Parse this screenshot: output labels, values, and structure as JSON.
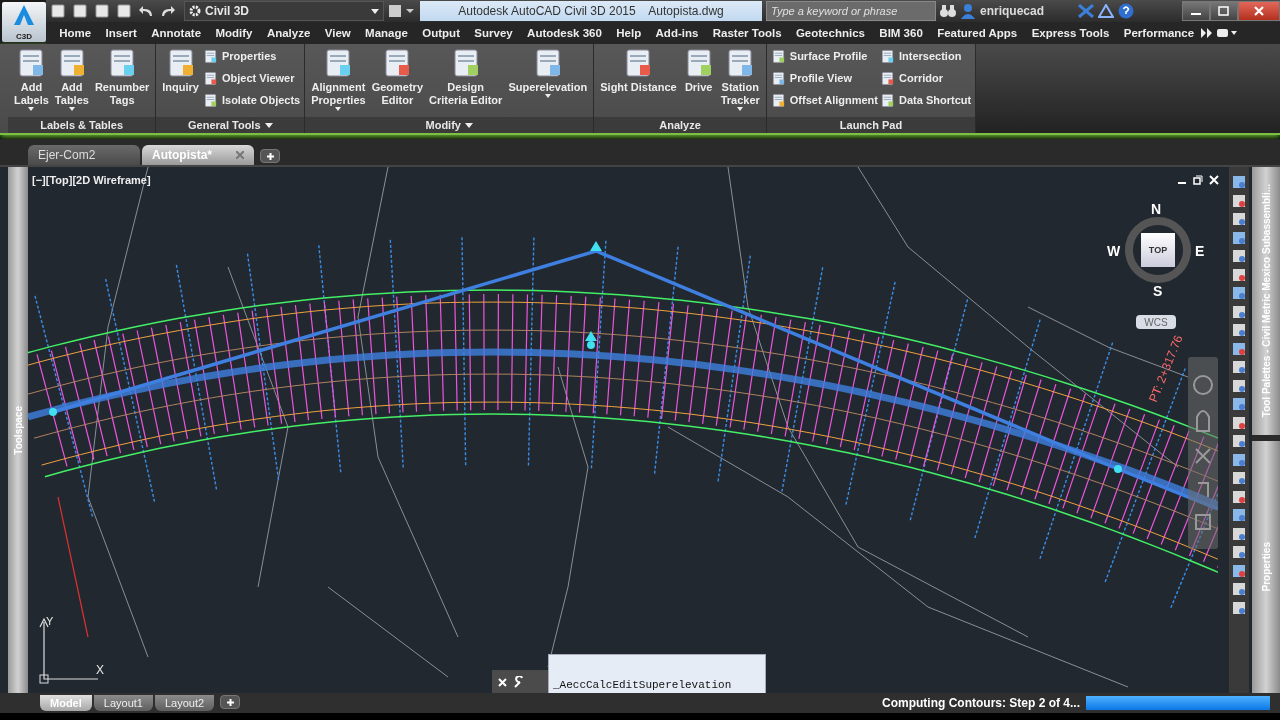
{
  "app_button": {
    "label": "C3D"
  },
  "quick_access": {
    "workspace": "Civil 3D"
  },
  "title_bar": {
    "title": "Autodesk AutoCAD Civil 3D 2015    Autopista.dwg",
    "search": {
      "placeholder": "Type a keyword or phrase"
    },
    "user": "enriquecad"
  },
  "menu_tabs": [
    {
      "label": "Home",
      "selected": false
    },
    {
      "label": "Insert",
      "selected": false
    },
    {
      "label": "Annotate",
      "selected": false
    },
    {
      "label": "Modify",
      "selected": false
    },
    {
      "label": "Analyze",
      "selected": false
    },
    {
      "label": "View",
      "selected": false
    },
    {
      "label": "Manage",
      "selected": false
    },
    {
      "label": "Output",
      "selected": false
    },
    {
      "label": "Survey",
      "selected": false
    },
    {
      "label": "Autodesk 360",
      "selected": false
    },
    {
      "label": "Help",
      "selected": false
    },
    {
      "label": "Add-ins",
      "selected": false
    },
    {
      "label": "Raster Tools",
      "selected": false
    },
    {
      "label": "Geotechnics",
      "selected": false
    },
    {
      "label": "BIM 360",
      "selected": false
    },
    {
      "label": "Featured Apps",
      "selected": false
    },
    {
      "label": "Express Tools",
      "selected": false
    },
    {
      "label": "Performance",
      "selected": false
    }
  ],
  "ribbon_panels": [
    {
      "title": "Labels & Tables",
      "menu": false,
      "items": [
        {
          "kind": "large",
          "label": "Add\nLabels",
          "dropdown": true
        },
        {
          "kind": "large",
          "label": "Add\nTables",
          "dropdown": true
        },
        {
          "kind": "large",
          "label": "Renumber\nTags",
          "dropdown": false
        }
      ]
    },
    {
      "title": "General Tools",
      "menu": true,
      "items": [
        {
          "kind": "large",
          "label": "Inquiry",
          "dropdown": false
        },
        {
          "kind": "small",
          "label": "Properties"
        },
        {
          "kind": "small",
          "label": "Object Viewer"
        },
        {
          "kind": "small",
          "label": "Isolate Objects"
        }
      ]
    },
    {
      "title": "Modify",
      "menu": true,
      "items": [
        {
          "kind": "large",
          "label": "Alignment\nProperties",
          "dropdown": true
        },
        {
          "kind": "large",
          "label": "Geometry\nEditor",
          "dropdown": false
        },
        {
          "kind": "large",
          "label": "Design\nCriteria Editor",
          "dropdown": false
        },
        {
          "kind": "large",
          "label": "Superelevation",
          "dropdown": true
        }
      ]
    },
    {
      "title": "Analyze",
      "menu": false,
      "items": [
        {
          "kind": "large",
          "label": "Sight Distance",
          "dropdown": false
        },
        {
          "kind": "large",
          "label": "Drive",
          "dropdown": false
        },
        {
          "kind": "large",
          "label": "Station\nTracker",
          "dropdown": true
        }
      ]
    },
    {
      "title": "Launch Pad",
      "menu": false,
      "items": [
        {
          "kind": "small",
          "label": "Surface Profile"
        },
        {
          "kind": "small",
          "label": "Profile View"
        },
        {
          "kind": "small",
          "label": "Offset Alignment"
        },
        {
          "kind": "small",
          "label": "Intersection"
        },
        {
          "kind": "small",
          "label": "Corridor"
        },
        {
          "kind": "small",
          "label": "Data Shortcut"
        }
      ]
    }
  ],
  "document_tabs": [
    {
      "label": "Ejer-Com2",
      "selected": false
    },
    {
      "label": "Autopista*",
      "selected": true
    }
  ],
  "toolspace": {
    "label": "Toolspace"
  },
  "viewport": {
    "label": "[−][Top][2D Wireframe]",
    "station_label": "PT: 2+317.76",
    "view_cube": {
      "top": "TOP",
      "north": "N",
      "south": "S",
      "east": "E",
      "west": "W",
      "ucs": "WCS"
    },
    "ucs_axis": {
      "y": "Y",
      "x": "X"
    }
  },
  "command_line": {
    "text": "_AeccCalcEditSuperelevation"
  },
  "palettes": [
    {
      "label": "Tool Palettes - Civil Metric Mexico Subassembli..."
    },
    {
      "label": "Properties"
    }
  ],
  "layout_tabs": [
    {
      "label": "Model",
      "selected": true
    },
    {
      "label": "Layout1",
      "selected": false
    },
    {
      "label": "Layout2",
      "selected": false
    }
  ],
  "status_bar": {
    "text": "Computing Contours: Step 2 of 4...",
    "level": 1.0
  }
}
